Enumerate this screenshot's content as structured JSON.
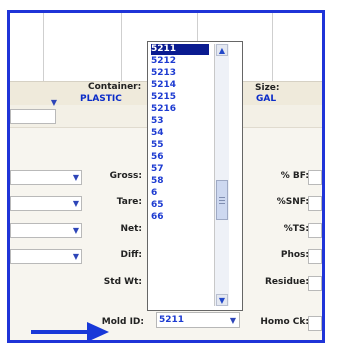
{
  "header": {
    "container_label": "Container:",
    "container_value": "PLASTIC",
    "size_label": "Size:",
    "size_value": "GAL"
  },
  "left_labels": {
    "gross": "Gross:",
    "tare": "Tare:",
    "net": "Net:",
    "diff": "Diff:",
    "std_wt": "Std Wt:",
    "mold_id": "Mold ID:"
  },
  "right_labels": {
    "bf": "% BF:",
    "snf": "%SNF:",
    "ts": "%TS:",
    "phos": "Phos:",
    "residue": "Residue:",
    "homo_ck": "Homo Ck:"
  },
  "dropdown": {
    "items": [
      "5211",
      "5212",
      "5213",
      "5214",
      "5215",
      "5216",
      "53",
      "54",
      "55",
      "56",
      "57",
      "58",
      "6",
      "65",
      "66"
    ],
    "selected_item": "5211",
    "current_value": "5211"
  },
  "icons": {
    "scroll_up": "scroll-up-icon",
    "scroll_down": "scroll-down-icon",
    "dropdown_arrow": "chevron-down-icon",
    "callout_arrow": "callout-arrow-icon"
  },
  "colors": {
    "frame_border": "#1f34d8",
    "list_text": "#1d3bd1",
    "selected_bg": "#0a1b90",
    "arrow": "#1838d8"
  }
}
